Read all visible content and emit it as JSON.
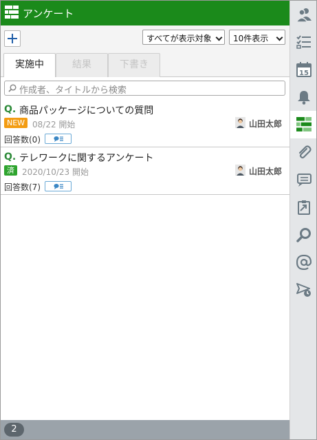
{
  "app": {
    "title": "アンケート"
  },
  "toolbar": {
    "target_select": "すべてが表示対象",
    "count_select": "10件表示"
  },
  "tabs": [
    {
      "label": "実施中",
      "active": true
    },
    {
      "label": "結果",
      "active": false
    },
    {
      "label": "下書き",
      "active": false
    }
  ],
  "search": {
    "placeholder": "作成者、タイトルから検索"
  },
  "items": [
    {
      "q_mark": "Q.",
      "title": "商品パッケージについての質問",
      "badge": "NEW",
      "date_text": "08/22 開始",
      "author": "山田太郎",
      "answers": "回答数(0)"
    },
    {
      "q_mark": "Q.",
      "title": "テレワークに関するアンケート",
      "badge": "済",
      "date_text": "2020/10/23 開始",
      "author": "山田太郎",
      "answers": "回答数(7)"
    }
  ],
  "footer": {
    "count": "2"
  },
  "sidebar": {
    "icons": [
      "people-icon",
      "checklist-icon",
      "calendar-icon",
      "bell-icon",
      "survey-icon",
      "paperclip-icon",
      "message-icon",
      "clipboard-icon",
      "search-icon",
      "at-icon",
      "send-clock-icon"
    ],
    "calendar_day": "15",
    "active_icon": "survey-icon"
  },
  "colors": {
    "header": "#1b8a1b",
    "accent": "#2e8b3a",
    "new_badge": "#f39c12",
    "done_badge": "#2ea42e",
    "sidebar_icon": "#6b7a84"
  }
}
